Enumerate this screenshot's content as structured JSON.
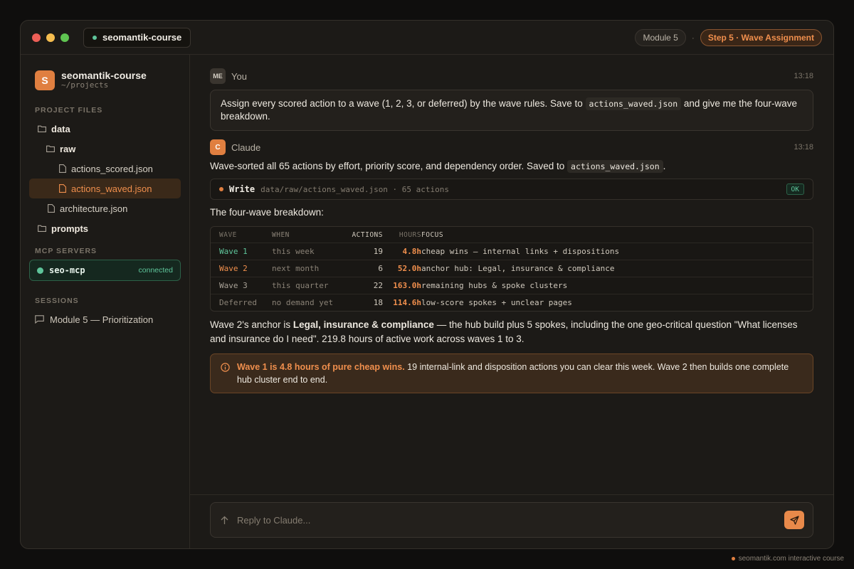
{
  "titlebar": {
    "project": "seomantik-course",
    "module": "Module 5",
    "separator": "·",
    "step": "Step 5 · Wave Assignment"
  },
  "sidebar": {
    "project_name": "seomantik-course",
    "project_initial": "S",
    "project_path": "~/projects",
    "files_label": "PROJECT FILES",
    "files": [
      {
        "label": "data",
        "type": "folder"
      },
      {
        "label": "raw",
        "type": "folder"
      },
      {
        "label": "actions_scored.json",
        "type": "file"
      },
      {
        "label": "actions_waved.json",
        "type": "file",
        "active": true
      },
      {
        "label": "architecture.json",
        "type": "file"
      },
      {
        "label": "prompts",
        "type": "folder"
      }
    ],
    "mcp_label": "MCP SERVERS",
    "mcp": {
      "name": "seo-mcp",
      "status": "connected"
    },
    "sessions_label": "SESSIONS",
    "sessions": [
      {
        "label": "Module 5 — Prioritization"
      }
    ]
  },
  "chat": {
    "user": {
      "initials": "ME",
      "author": "You",
      "time": "13:18",
      "text_before": "Assign every scored action to a wave (1, 2, 3, or deferred) by the wave rules. Save to ",
      "code": "actions_waved.json",
      "text_after": " and give me the four-wave breakdown."
    },
    "assistant": {
      "initial": "C",
      "author": "Claude",
      "time": "13:18",
      "intro_before": "Wave-sorted all 65 actions by effort, priority score, and dependency order. Saved to ",
      "intro_code": "actions_waved.json",
      "intro_after": ".",
      "tool": {
        "name": "Write",
        "path": "data/raw/actions_waved.json · 65 actions",
        "status": "OK"
      },
      "breakdown_label": "The four-wave breakdown:",
      "table": {
        "headers": {
          "wave": "WAVE",
          "when": "WHEN",
          "actions": "ACTIONS",
          "hours": "HOURS",
          "focus": "FOCUS"
        },
        "rows": [
          {
            "wave": "Wave 1",
            "when": "this week",
            "actions": "19",
            "hours": "4.8h",
            "focus": "cheap wins — internal links + dispositions",
            "wave_color": "#5ec49a",
            "hours_color": "#f08f4d"
          },
          {
            "wave": "Wave 2",
            "when": "next month",
            "actions": "6",
            "hours": "52.0h",
            "focus": "anchor hub: Legal, insurance & compliance",
            "wave_color": "#f08f4d",
            "hours_color": "#f08f4d"
          },
          {
            "wave": "Wave 3",
            "when": "this quarter",
            "actions": "22",
            "hours": "163.0h",
            "focus": "remaining hubs & spoke clusters",
            "wave_color": "#a8a196",
            "hours_color": "#f08f4d"
          },
          {
            "wave": "Deferred",
            "when": "no demand yet",
            "actions": "18",
            "hours": "114.6h",
            "focus": "low-score spokes + unclear pages",
            "wave_color": "#8a8276",
            "hours_color": "#f08f4d"
          }
        ]
      },
      "summary_before": "Wave 2's anchor is ",
      "summary_bold": "Legal, insurance & compliance",
      "summary_after": " — the hub build plus 5 spokes, including the one geo-critical question \"What licenses and insurance do I need\". 219.8 hours of active work across waves 1 to 3.",
      "callout_bold": "Wave 1 is 4.8 hours of pure cheap wins.",
      "callout_text": " 19 internal-link and disposition actions you can clear this week. Wave 2 then builds one complete hub cluster end to end."
    }
  },
  "composer": {
    "placeholder": "Reply to Claude..."
  },
  "footer": {
    "text": "seomantik.com interactive course"
  }
}
